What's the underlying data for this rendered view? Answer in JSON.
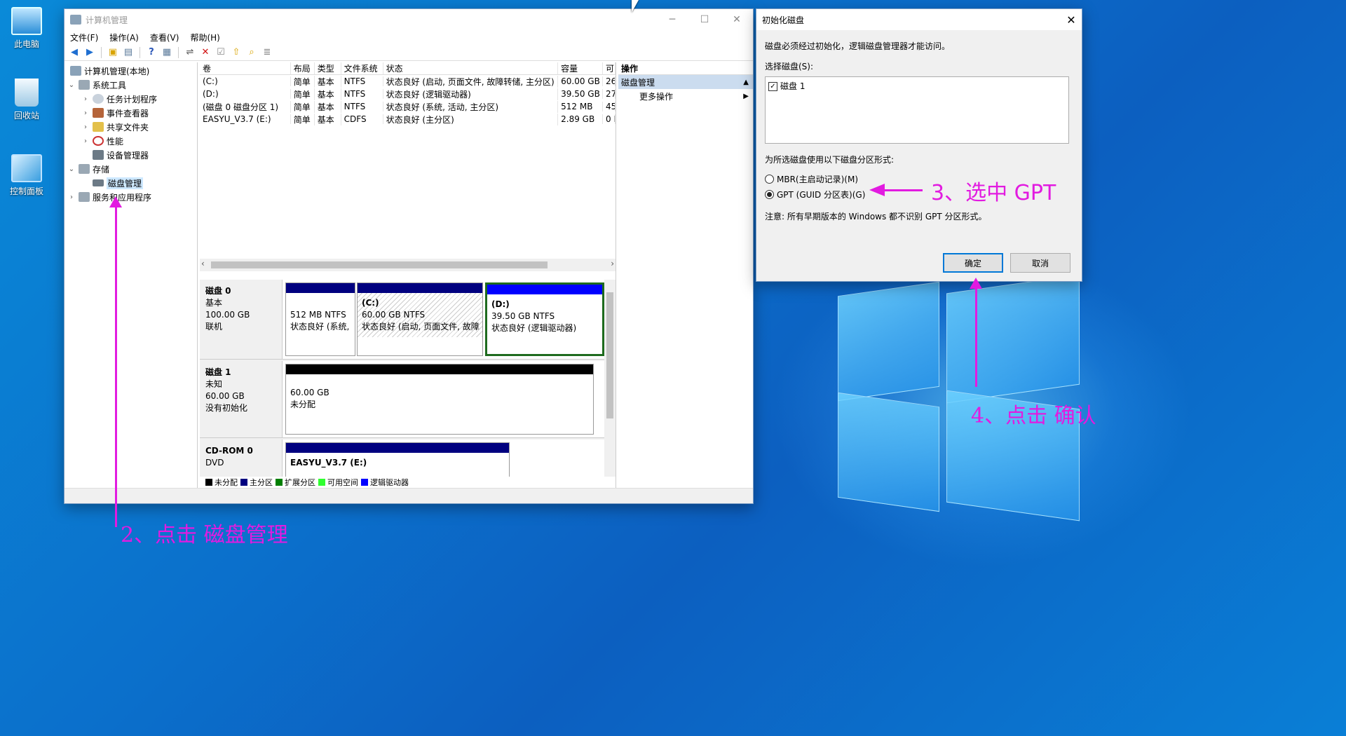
{
  "desktop": {
    "icons": [
      {
        "label": "此电脑",
        "icon": "computer-icon"
      },
      {
        "label": "回收站",
        "icon": "recycle-bin-icon"
      },
      {
        "label": "控制面板",
        "icon": "control-panel-icon"
      }
    ]
  },
  "window": {
    "title": "计算机管理",
    "controls": {
      "minimize": "─",
      "maximize": "☐",
      "close": "✕"
    },
    "menu": [
      "文件(F)",
      "操作(A)",
      "查看(V)",
      "帮助(H)"
    ],
    "tree": {
      "root": "计算机管理(本地)",
      "system_tools": "系统工具",
      "task_scheduler": "任务计划程序",
      "event_viewer": "事件查看器",
      "shared_folders": "共享文件夹",
      "performance": "性能",
      "device_manager": "设备管理器",
      "storage": "存储",
      "disk_management": "磁盘管理",
      "services_apps": "服务和应用程序"
    },
    "volume_table": {
      "headers": [
        "卷",
        "布局",
        "类型",
        "文件系统",
        "状态",
        "容量",
        "可"
      ],
      "rows": [
        [
          "(C:)",
          "简单",
          "基本",
          "NTFS",
          "状态良好 (启动, 页面文件, 故障转储, 主分区)",
          "60.00 GB",
          "26"
        ],
        [
          "(D:)",
          "简单",
          "基本",
          "NTFS",
          "状态良好 (逻辑驱动器)",
          "39.50 GB",
          "27"
        ],
        [
          "(磁盘 0 磁盘分区 1)",
          "简单",
          "基本",
          "NTFS",
          "状态良好 (系统, 活动, 主分区)",
          "512 MB",
          "45"
        ],
        [
          "EASYU_V3.7 (E:)",
          "简单",
          "基本",
          "CDFS",
          "状态良好 (主分区)",
          "2.89 GB",
          "0 I"
        ]
      ],
      "scroll_left": "‹",
      "scroll_right": "›"
    },
    "disks": {
      "disk0": {
        "name": "磁盘 0",
        "type": "基本",
        "size": "100.00 GB",
        "status": "联机",
        "p1_size": "512 MB NTFS",
        "p1_status": "状态良好 (系统,",
        "p2_name": "(C:)",
        "p2_size": "60.00 GB NTFS",
        "p2_status": "状态良好 (启动, 页面文件, 故障",
        "p3_name": "(D:)",
        "p3_size": "39.50 GB NTFS",
        "p3_status": "状态良好 (逻辑驱动器)"
      },
      "disk1": {
        "name": "磁盘 1",
        "type": "未知",
        "size": "60.00 GB",
        "status": "没有初始化",
        "p1_size": "60.00 GB",
        "p1_status": "未分配"
      },
      "cdrom": {
        "name": "CD-ROM 0",
        "type": "DVD",
        "p1_name": "EASYU_V3.7 (E:)"
      }
    },
    "legend": [
      {
        "label": "未分配",
        "color": "#000000"
      },
      {
        "label": "主分区",
        "color": "#00007f"
      },
      {
        "label": "扩展分区",
        "color": "#007f00"
      },
      {
        "label": "可用空间",
        "color": "#30ff30"
      },
      {
        "label": "逻辑驱动器",
        "color": "#0000ff"
      }
    ],
    "actions": {
      "header": "操作",
      "section": "磁盘管理",
      "more": "更多操作"
    }
  },
  "dialog": {
    "title": "初始化磁盘",
    "close": "✕",
    "message": "磁盘必须经过初始化，逻辑磁盘管理器才能访问。",
    "select_label": "选择磁盘(S):",
    "disk_item": "磁盘 1",
    "style_label": "为所选磁盘使用以下磁盘分区形式:",
    "mbr_label": "MBR(主启动记录)(M)",
    "gpt_label": "GPT (GUID 分区表)(G)",
    "note": "注意: 所有早期版本的 Windows 都不识别 GPT 分区形式。",
    "ok": "确定",
    "cancel": "取消"
  },
  "annotations": {
    "step2": "2、点击 磁盘管理",
    "step3": "3、选中  GPT",
    "step4": "4、点击 确认"
  },
  "colors": {
    "annotation": "#e21be0",
    "primary_partition": "#00007f",
    "logical_drive": "#0000ff"
  }
}
